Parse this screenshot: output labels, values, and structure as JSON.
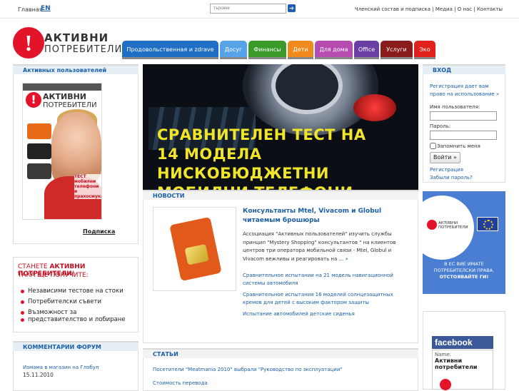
{
  "topbar": {
    "home": "Главная",
    "en": "EN",
    "search_placeholder": "търсене",
    "links": "Членский состав и подписка | Медиа | О нас | Контакты"
  },
  "logo": {
    "mark": "!",
    "line1": "АКТИВНИ",
    "line2": "ПОТРЕБИТЕЛИ"
  },
  "nav": {
    "tabs": [
      {
        "label": "Продовольственная и zdrave",
        "color": "#1f6fc4"
      },
      {
        "label": "Досуг",
        "color": "#56a3e8"
      },
      {
        "label": "Финансы",
        "color": "#3b9b2a"
      },
      {
        "label": "Дети",
        "color": "#f08a1c"
      },
      {
        "label": "Для дома",
        "color": "#b64bb0"
      },
      {
        "label": "Office",
        "color": "#6a3fa3"
      },
      {
        "label": "Услуги",
        "color": "#8a1b1b"
      },
      {
        "label": "Эко",
        "color": "#e0211c"
      }
    ]
  },
  "left": {
    "members_title": "Активных пользователей",
    "cover": {
      "mark": "!",
      "line1": "АКТИВНИ",
      "line2": "ПОТРЕБИТЕЛИ",
      "tagline": "ТЕСТ мобилни телефони и прахосмукачки"
    },
    "subscribe": "Подписка",
    "promo": {
      "line1_pre": "СТАНЕТЕ ",
      "line1_bold": "АКТИВНИ ПОТРЕБИТЕЛИ",
      "line1_post": "!",
      "line2": "ТАКА ЩЕ ПОЛУЧИТЕ:",
      "items": [
        "Независими тестове на стоки",
        "Потребителски съвети",
        "Възможност за",
        "представителство и лобиране"
      ]
    },
    "forum_title": "КОММЕНТАРИИ ФОРУМ",
    "forum_item": "Измама в магазин на Глобул",
    "forum_date": "15.11.2010"
  },
  "hero": {
    "line1": "СРАВНИТЕЛЕН ТЕСТ НА",
    "line2": "14 МОДЕЛА НИСКОБЮДЖЕТНИ",
    "line3": "МОБИЛНИ ТЕЛЕФОНИ"
  },
  "news": {
    "title": "НОВОСТИ",
    "headline": "Консультанты Mtel, Vivacom и Globul читаемым брошюры",
    "body": "Ассоциация \"Активных пользователей\" изучить службы принцип \"Mystery Shopping\" консультантов \" на клиентов центров три оператора мобильной связи - Mtel, Globul и Vivacom вежливы и реагировать на ...",
    "more": "»",
    "items": [
      "Сравнительное испытании на 21 модель навигационной системы автомобиля",
      "Сравнительное испытания 16 моделей солнцезащитных кремов для детей с высоким фактором защиты",
      "Испытание автомобилей детские сиденья"
    ]
  },
  "articles": {
    "title": "СТАТЬИ",
    "items": [
      "Посетители \"Meatmania 2010\" выбрали \"Руководство по эксплуатации\"",
      "Стоимость перевода"
    ]
  },
  "login": {
    "title": "ВХОД",
    "intro": "Регистрация дает вам право на использование »",
    "username_label": "Имя пользователя:",
    "password_label": "Пароль:",
    "remember": "Запомнить меня",
    "submit": "Войти »",
    "register": "Регистрация",
    "forgot": "Забыли пароль?"
  },
  "eu": {
    "line1": "В ЕС ВИЕ ИМАТЕ",
    "line2": "ПОТРЕБИТЕЛСКИ ПРАВА.",
    "line3": "ОТСТОЯВАЙТЕ ГИ!",
    "logo_text": "АКТИВНИ ПОТРЕБИТЕЛИ"
  },
  "facebook": {
    "brand": "facebook",
    "name_label": "Name:",
    "name_line1": "Активни",
    "name_line2": "потребители"
  }
}
